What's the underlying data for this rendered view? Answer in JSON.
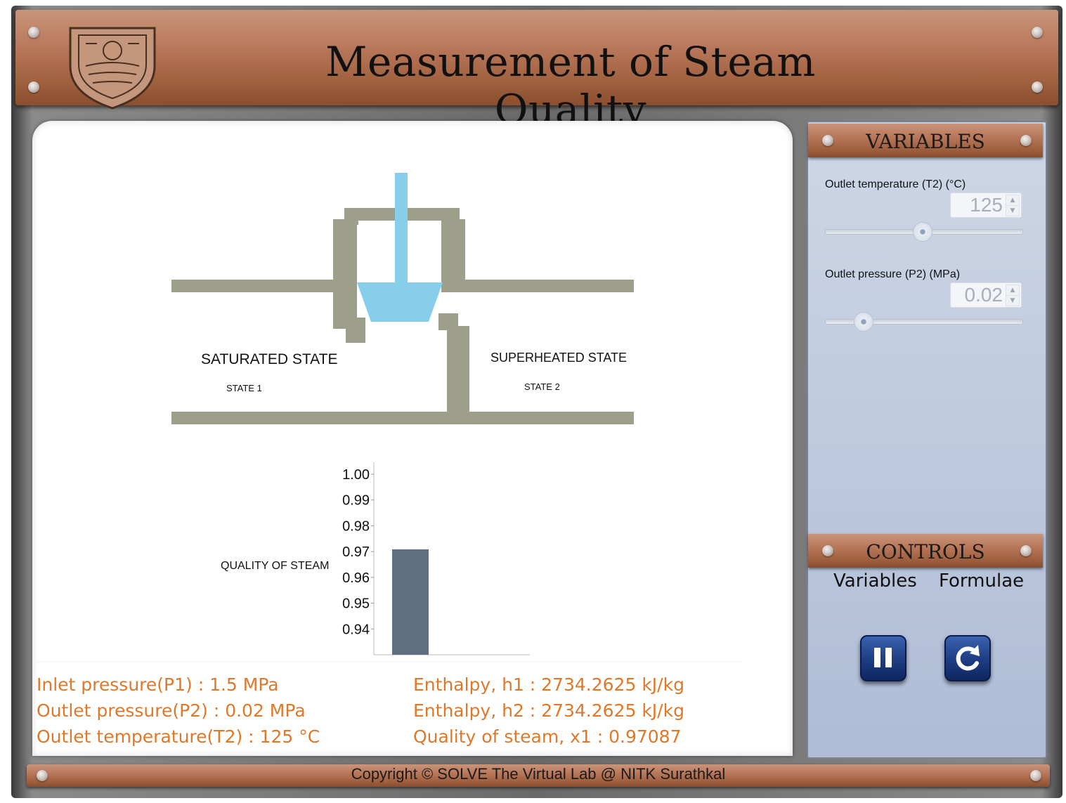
{
  "header": {
    "title": "Measurement of Steam Quality"
  },
  "diagram": {
    "left_state_title": "SATURATED STATE",
    "left_state_sub": "STATE 1",
    "right_state_title": "SUPERHEATED STATE",
    "right_state_sub": "STATE 2"
  },
  "chart_data": {
    "type": "bar",
    "ylabel": "QUALITY OF STEAM",
    "ylim": [
      0.93,
      1.0
    ],
    "ticks": [
      "1.00",
      "0.99",
      "0.98",
      "0.97",
      "0.96",
      "0.95",
      "0.94"
    ],
    "categories": [
      ""
    ],
    "values": [
      0.97087
    ],
    "color": "#5f6e80"
  },
  "readouts": {
    "left": [
      "Inlet pressure(P1) : 1.5 MPa",
      "Outlet pressure(P2) : 0.02 MPa",
      "Outlet temperature(T2) : 125 °C"
    ],
    "right": [
      "Enthalpy, h1 : 2734.2625 kJ/kg",
      "Enthalpy, h2 : 2734.2625 kJ/kg",
      "Quality of steam, x1 : 0.97087"
    ]
  },
  "variables": {
    "title": "VARIABLES",
    "t2_label": "Outlet temperature (T2) (°C)",
    "t2_value": "125",
    "t2_level": 0.49,
    "p2_label": "Outlet pressure (P2) (MPa)",
    "p2_value": "0.02",
    "p2_level": 0.19
  },
  "controls": {
    "title": "CONTROLS",
    "tab_variables": "Variables",
    "tab_formulae": "Formulae",
    "pause_icon": "pause-icon",
    "reset_icon": "reset-icon"
  },
  "footer": {
    "copyright": "Copyright © SOLVE The Virtual Lab @ NITK Surathkal"
  }
}
